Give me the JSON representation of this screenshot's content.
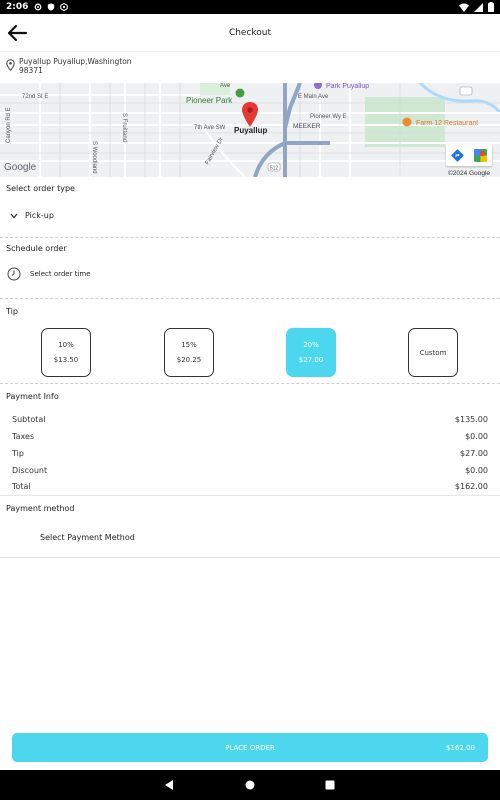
{
  "status_bar": {
    "time": "2:06",
    "icons": [
      "settings-icon",
      "shield-icon",
      "gear-icon",
      "wifi-icon",
      "signal-icon",
      "battery-icon"
    ]
  },
  "header": {
    "title": "Checkout",
    "back_icon": "arrow-left-icon"
  },
  "address": {
    "line1": "Puyallup  Puyallup,Washington",
    "line2": "98371"
  },
  "map": {
    "labels": {
      "street_72nd": "72nd St E",
      "ave": "Ave",
      "park": "Pioneer Park",
      "e_main": "E Main Ave",
      "park_puyallup": "Park Puyallup",
      "pioneer_way": "Pioneer Wy E",
      "seventh": "7th Ave SW",
      "city": "Puyallup",
      "meeker": "MEEKER",
      "farm": "Farm 12 Restaurant",
      "canyon": "Canyon Rd E",
      "woodland": "S Woodland",
      "fruitland": "S Fruitland",
      "fairview": "Fairview Dr",
      "route": "512",
      "copyright": "©2024 Google",
      "logo": "Google"
    },
    "colors": {
      "pin": "#e53935",
      "highway": "#8fa6c4",
      "park": "#cfe8d2",
      "water": "#aadaff"
    }
  },
  "order_type": {
    "label": "Select order type",
    "value": "Pick-up"
  },
  "schedule": {
    "label": "Schedule order",
    "action": "Select order time"
  },
  "tip": {
    "label": "Tip",
    "options": [
      {
        "percent": "10%",
        "amount": "$13.50",
        "selected": false
      },
      {
        "percent": "15%",
        "amount": "$20.25",
        "selected": false
      },
      {
        "percent": "20%",
        "amount": "$27.00",
        "selected": true
      },
      {
        "percent": "Custom",
        "amount": "",
        "selected": false
      }
    ]
  },
  "payment_info": {
    "label": "Payment Info",
    "rows": [
      {
        "label": "Subtotal",
        "value": "$135.00"
      },
      {
        "label": "Taxes",
        "value": "$0.00"
      },
      {
        "label": "Tip",
        "value": "$27.00"
      },
      {
        "label": "Discount",
        "value": "$0.00"
      },
      {
        "label": "Total",
        "value": "$162.00"
      }
    ]
  },
  "payment_method": {
    "label": "Payment method",
    "action": "Select Payment Method"
  },
  "place_order": {
    "label": "PLACE ORDER",
    "amount": "$162.00",
    "color": "#4dd7ef"
  }
}
